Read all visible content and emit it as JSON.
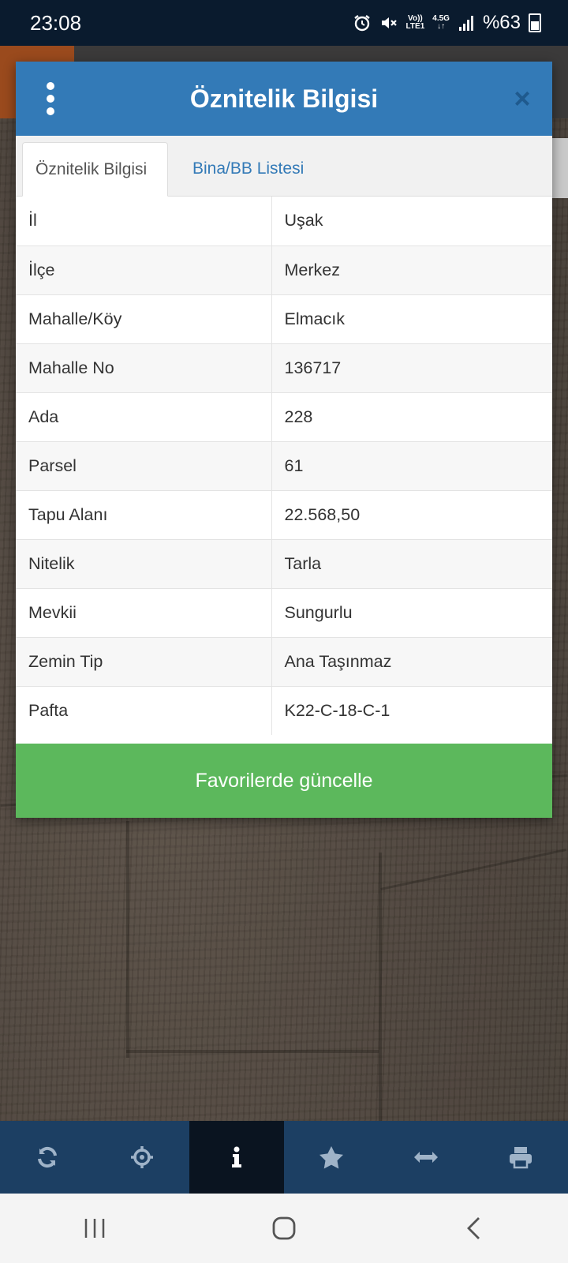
{
  "status_bar": {
    "time": "23:08",
    "icons": [
      "alarm-icon",
      "mute-icon",
      "volte-icon",
      "network-4.5g-icon",
      "signal-icon"
    ],
    "volte_top": "Vo))",
    "volte_bottom": "LTE1",
    "network_label": "4.5G",
    "battery": "%63"
  },
  "dialog": {
    "title": "Öznitelik Bilgisi",
    "close_label": "×",
    "tabs": [
      {
        "label": "Öznitelik Bilgisi",
        "active": true
      },
      {
        "label": "Bina/BB Listesi",
        "active": false
      }
    ],
    "rows": [
      {
        "key": "İl",
        "value": "Uşak"
      },
      {
        "key": "İlçe",
        "value": "Merkez"
      },
      {
        "key": "Mahalle/Köy",
        "value": "Elmacık"
      },
      {
        "key": "Mahalle No",
        "value": "136717"
      },
      {
        "key": "Ada",
        "value": "228"
      },
      {
        "key": "Parsel",
        "value": "61"
      },
      {
        "key": "Tapu Alanı",
        "value": "22.568,50"
      },
      {
        "key": "Nitelik",
        "value": "Tarla"
      },
      {
        "key": "Mevkii",
        "value": "Sungurlu"
      },
      {
        "key": "Zemin Tip",
        "value": "Ana Taşınmaz"
      },
      {
        "key": "Pafta",
        "value": "K22-C-18-C-1"
      }
    ],
    "action_button": "Favorilerde güncelle"
  },
  "toolbar": {
    "items": [
      "refresh-icon",
      "locate-icon",
      "info-icon",
      "star-icon",
      "measure-icon",
      "print-icon"
    ],
    "active_index": 2
  },
  "navbar": {
    "items": [
      "recent-apps-icon",
      "home-icon",
      "back-icon"
    ]
  },
  "colors": {
    "header": "#337ab7",
    "action_button": "#5cb85c",
    "toolbar": "#1c3f63",
    "status_bar": "#0a1b2e"
  }
}
